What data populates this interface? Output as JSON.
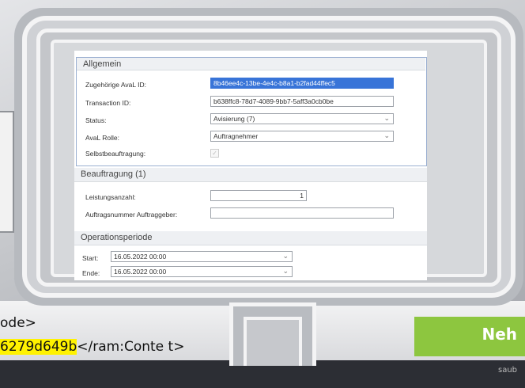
{
  "background": {
    "code_line_1": "ode>",
    "code_line_2_highlight": "6279d649b",
    "code_line_2_tail": "</ram:Conte",
    "code_line_2_end": "t>",
    "badge_text": "Neh",
    "badge_subtext": "saub"
  },
  "colors": {
    "selection": "#3874d8",
    "badge_green": "#8dc63f",
    "highlight": "#fff200"
  },
  "form": {
    "allgemein": {
      "title": "Allgemein",
      "aval_id_label": "Zugehörige AvaL ID:",
      "aval_id_value": "8b46ee4c-13be-4e4c-b8a1-b2fad44ffec5",
      "transaction_label": "Transaction ID:",
      "transaction_value": "b638ffc8-78d7-4089-9bb7-5aff3a0cb0be",
      "status_label": "Status:",
      "status_value": "Avisierung (7)",
      "rolle_label": "AvaL Rolle:",
      "rolle_value": "Auftragnehmer",
      "selbst_label": "Selbstbeauftragung:",
      "selbst_checked": true
    },
    "beauftragung": {
      "title": "Beauftragung (1)",
      "leistung_label": "Leistungsanzahl:",
      "leistung_value": "1",
      "auftragsnr_label": "Auftragsnummer Auftraggeber:",
      "auftragsnr_value": ""
    },
    "operation": {
      "title": "Operationsperiode",
      "start_label": "Start:",
      "start_value": "16.05.2022 00:00",
      "ende_label": "Ende:",
      "ende_value": "16.05.2022 00:00"
    }
  }
}
